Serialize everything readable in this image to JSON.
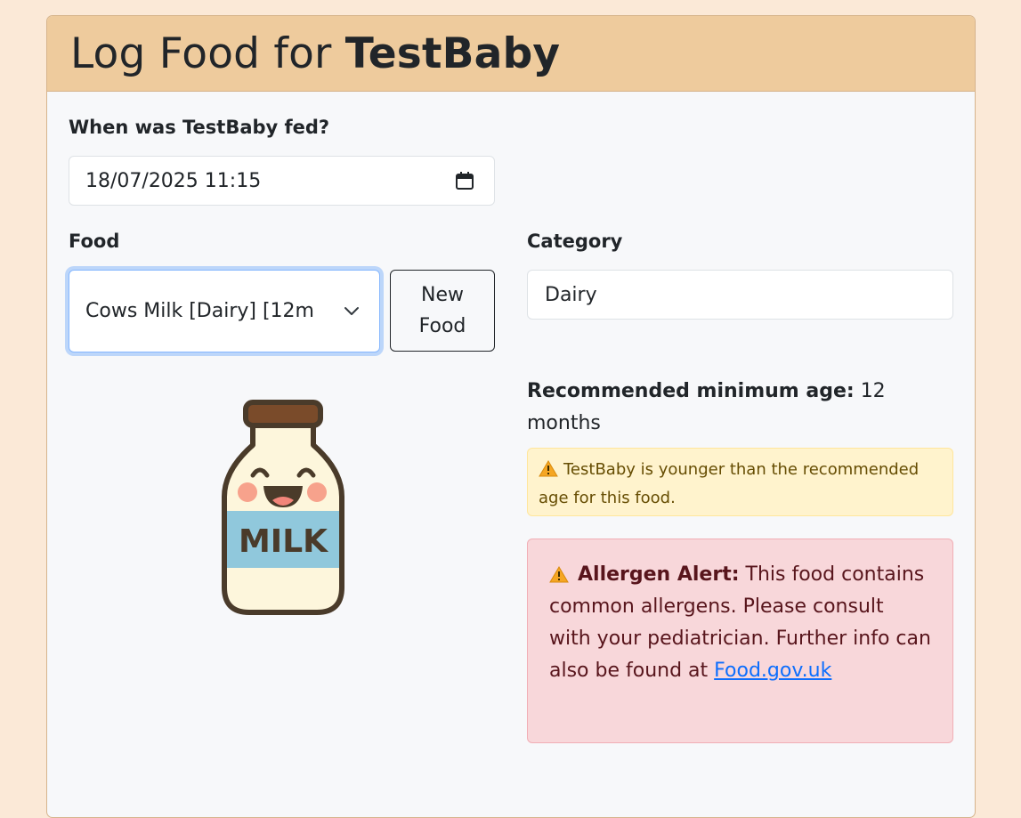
{
  "header": {
    "title_prefix": "Log Food for ",
    "baby_name": "TestBaby"
  },
  "fed_time": {
    "label": "When was TestBaby fed?",
    "value": "18/07/2025 11:15",
    "icon": "calendar-icon"
  },
  "food": {
    "label": "Food",
    "selected": "Cows Milk [Dairy] [12m",
    "new_food_label": "New Food"
  },
  "category": {
    "label": "Category",
    "value": "Dairy"
  },
  "min_age": {
    "label": "Recommended minimum age:",
    "value": "12 months"
  },
  "age_warning": {
    "icon": "warning-icon",
    "text": "TestBaby is younger than the recommended age for this food."
  },
  "allergen_alert": {
    "icon": "warning-icon",
    "title": "Allergen Alert:",
    "text": "This food contains common allergens. Please consult with your pediatrician. Further info can also be found at",
    "link_text": "Food.gov.uk"
  },
  "food_image": {
    "label": "MILK",
    "colors": {
      "cap": "#7a4b2a",
      "bottle": "#fdf6dc",
      "band": "#90c8dc",
      "outline": "#4a3b2a",
      "cheeks": "#f7a28c"
    }
  },
  "colors": {
    "page_bg": "#fbe9d7",
    "header_bg": "#eecb9d",
    "warning_bg": "#fff3cd",
    "danger_bg": "#f8d7da",
    "link": "#0d6efd"
  }
}
